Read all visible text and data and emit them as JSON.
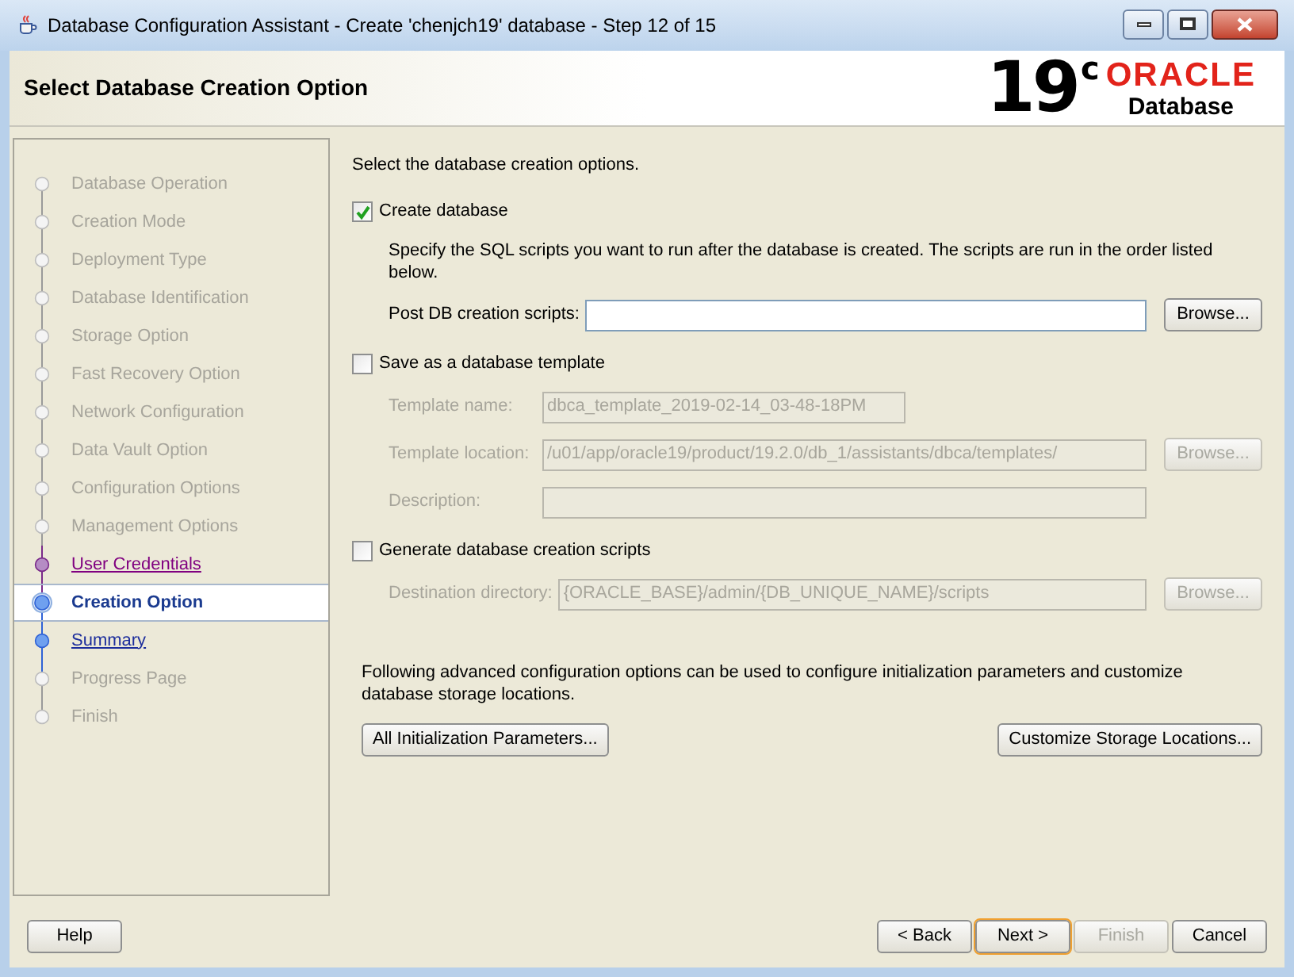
{
  "window": {
    "title": "Database Configuration Assistant - Create 'chenjch19' database - Step 12 of 15"
  },
  "header": {
    "title": "Select Database Creation Option",
    "logo": {
      "version": "19",
      "version_suffix": "c",
      "brand": "ORACLE",
      "product": "Database"
    }
  },
  "steps": [
    {
      "label": "Database Operation",
      "kind": "disabled",
      "selected": false
    },
    {
      "label": "Creation Mode",
      "kind": "disabled",
      "selected": false
    },
    {
      "label": "Deployment Type",
      "kind": "disabled",
      "selected": false
    },
    {
      "label": "Database Identification",
      "kind": "disabled",
      "selected": false
    },
    {
      "label": "Storage Option",
      "kind": "disabled",
      "selected": false
    },
    {
      "label": "Fast Recovery Option",
      "kind": "disabled",
      "selected": false
    },
    {
      "label": "Network Configuration",
      "kind": "disabled",
      "selected": false
    },
    {
      "label": "Data Vault Option",
      "kind": "disabled",
      "selected": false
    },
    {
      "label": "Configuration Options",
      "kind": "disabled",
      "selected": false
    },
    {
      "label": "Management Options",
      "kind": "disabled",
      "selected": false
    },
    {
      "label": "User Credentials",
      "kind": "visited",
      "selected": false
    },
    {
      "label": "Creation Option",
      "kind": "current",
      "selected": true
    },
    {
      "label": "Summary",
      "kind": "link",
      "selected": false
    },
    {
      "label": "Progress Page",
      "kind": "disabled",
      "selected": false
    },
    {
      "label": "Finish",
      "kind": "disabled",
      "selected": false
    }
  ],
  "content": {
    "intro": "Select the database creation options.",
    "sections": [
      {
        "label": "Create database",
        "checked": true,
        "description": "Specify the SQL scripts you want to run after the database is created. The scripts are run in the order listed below.",
        "fields": [
          {
            "label": "Post DB creation scripts:",
            "kind": "wide",
            "disabled": false,
            "button": "Browse..."
          }
        ]
      },
      {
        "label": "Save as a database template",
        "checked": false,
        "fields": [
          {
            "label": "Template name:",
            "kind": "short",
            "disabled": true,
            "value": "dbca_template_2019-02-14_03-48-18PM"
          },
          {
            "label": "Template location:",
            "kind": "wide",
            "disabled": true,
            "value": "/u01/app/oracle19/product/19.2.0/db_1/assistants/dbca/templates/",
            "button": "Browse..."
          },
          {
            "label": "Description:",
            "kind": "wide",
            "disabled": true
          }
        ]
      },
      {
        "label": "Generate database creation scripts",
        "checked": false,
        "fields": [
          {
            "label": "Destination directory:",
            "kind": "wide",
            "disabled": true,
            "value": "{ORACLE_BASE}/admin/{DB_UNIQUE_NAME}/scripts",
            "button": "Browse..."
          }
        ]
      }
    ],
    "advanced": {
      "text": "Following advanced configuration options can be used to configure initialization parameters and customize database storage locations.",
      "buttons": [
        "All Initialization Parameters...",
        "Customize Storage Locations..."
      ]
    }
  },
  "footer": {
    "help": "Help",
    "buttons": [
      {
        "label": "< Back",
        "disabled": false,
        "focused": false
      },
      {
        "label": "Next >",
        "disabled": false,
        "focused": true
      },
      {
        "label": "Finish",
        "disabled": true,
        "focused": false
      },
      {
        "label": "Cancel",
        "disabled": false,
        "focused": false
      }
    ]
  }
}
